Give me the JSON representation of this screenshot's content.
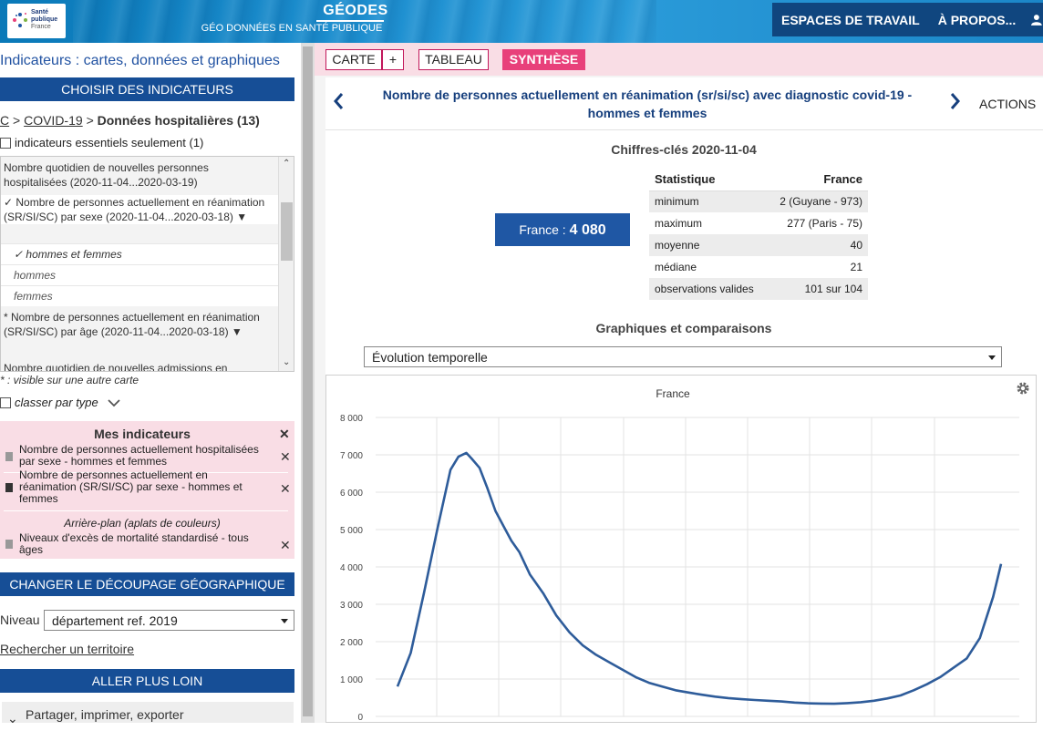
{
  "header": {
    "logo_line1": "Santé",
    "logo_line2": "publique",
    "logo_line3": "France",
    "app_title": "GÉODES",
    "app_subtitle": "GÉO DONNÉES EN SANTÉ PUBLIQUE",
    "nav": [
      "ESPACES DE TRAVAIL",
      "À PROPOS..."
    ]
  },
  "sidebar": {
    "title": "Indicateurs : cartes, données et graphiques",
    "choose_btn": "CHOISIR DES INDICATEURS",
    "crumb_c": "C",
    "crumb_covid": "COVID-19",
    "crumb_current": "Données hospitalières (13)",
    "essentials_label": "indicateurs essentiels seulement (1)",
    "list": {
      "item1": "Nombre quotidien de nouvelles personnes hospitalisées (2020-11-04...2020-03-19)",
      "item2": "✓ Nombre de personnes actuellement en réanimation (SR/SI/SC) par sexe (2020-11-04...2020-03-18) ▼",
      "sub_hf": "✓ hommes et femmes",
      "sub_h": "hommes",
      "sub_f": "femmes",
      "item3": "* Nombre de personnes actuellement en réanimation (SR/SI/SC) par âge (2020-11-04...2020-03-18) ▼",
      "item4": "Nombre quotidien de nouvelles admissions en"
    },
    "note": "* : visible sur une autre carte",
    "classer_label": "classer par type",
    "mes": {
      "header": "Mes indicateurs",
      "row1": "Nombre de personnes actuellement hospitalisées par sexe - hommes et femmes",
      "row2": "Nombre de personnes actuellement en réanimation (SR/SI/SC) par sexe - hommes et femmes",
      "arriere": "Arrière-plan (aplats de couleurs)",
      "row3": "Niveaux d'excès de mortalité standardisé - tous âges"
    },
    "decoupage_btn": "CHANGER LE DÉCOUPAGE GÉOGRAPHIQUE",
    "niveau_label": "Niveau",
    "niveau_value": "département ref. 2019",
    "search_link": "Rechercher un territoire",
    "plus_btn": "ALLER PLUS LOIN",
    "partager": "Partager, imprimer, exporter"
  },
  "tabs": {
    "carte": "CARTE",
    "plus": "+",
    "tableau": "TABLEAU",
    "synthese": "SYNTHÈSE"
  },
  "main": {
    "title": "Nombre de personnes actuellement en réanimation (sr/si/sc) avec diagnostic covid-19 - hommes et femmes",
    "actions": "ACTIONS",
    "key_title": "Chiffres-clés 2020-11-04",
    "kpi_label": "France : ",
    "kpi_value": "4 080",
    "stats_headers": [
      "Statistique",
      "France"
    ],
    "stats": [
      [
        "minimum",
        "2 (Guyane - 973)"
      ],
      [
        "maximum",
        "277 (Paris - 75)"
      ],
      [
        "moyenne",
        "40"
      ],
      [
        "médiane",
        "21"
      ],
      [
        "observations valides",
        "101 sur 104"
      ]
    ],
    "graph_title": "Graphiques et comparaisons",
    "graph_select": "Évolution temporelle"
  },
  "chart_data": {
    "type": "line",
    "title": "France",
    "xlabel": "",
    "ylabel": "",
    "ylim": [
      0,
      8000
    ],
    "yticks": [
      "0",
      "1 000",
      "2 000",
      "3 000",
      "4 000",
      "5 000",
      "6 000",
      "7 000",
      "8 000"
    ],
    "grid": true,
    "color": "#2e5c9a",
    "x": [
      0,
      5,
      10,
      15,
      20,
      23,
      26,
      28,
      31,
      34,
      37,
      40,
      43,
      46,
      50,
      55,
      60,
      65,
      70,
      75,
      80,
      85,
      90,
      95,
      100,
      105,
      110,
      115,
      120,
      125,
      130,
      135,
      140,
      145,
      150,
      155,
      160,
      165,
      170,
      175,
      180,
      185,
      190,
      195,
      200,
      205,
      210,
      215,
      220,
      225,
      228
    ],
    "y": [
      800,
      1700,
      3300,
      5000,
      6600,
      6950,
      7050,
      6900,
      6650,
      6100,
      5500,
      5100,
      4700,
      4400,
      3800,
      3300,
      2700,
      2250,
      1900,
      1650,
      1450,
      1250,
      1050,
      900,
      800,
      700,
      640,
      580,
      530,
      490,
      460,
      440,
      420,
      400,
      370,
      350,
      345,
      340,
      355,
      380,
      420,
      480,
      560,
      700,
      860,
      1050,
      1300,
      1550,
      2100,
      3200,
      4080
    ]
  }
}
